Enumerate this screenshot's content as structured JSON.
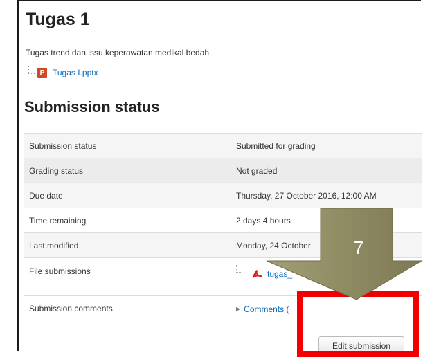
{
  "assignment": {
    "title": "Tugas 1",
    "description": "Tugas trend dan issu keperawatan medikal bedah",
    "attachment": {
      "file_name": "Tugas I.pptx",
      "icon": "powerpoint-file-icon"
    }
  },
  "submission": {
    "heading": "Submission status",
    "rows": [
      {
        "label": "Submission status",
        "value": "Submitted for grading"
      },
      {
        "label": "Grading status",
        "value": "Not graded"
      },
      {
        "label": "Due date",
        "value": "Thursday, 27 October 2016, 12:00 AM"
      },
      {
        "label": "Time remaining",
        "value": "2 days 4 hours"
      },
      {
        "label": "Last modified",
        "value": "Monday, 24 October"
      }
    ],
    "file_submissions": {
      "label": "File submissions",
      "file_name": "tugas_",
      "icon": "pdf-file-icon"
    },
    "comments": {
      "label": "Submission comments",
      "toggle": "Comments ("
    },
    "edit_button": "Edit submission"
  },
  "annotation": {
    "step_number": "7",
    "arrow_color": "#8f8b63",
    "box_color": "#f20000"
  },
  "colors": {
    "link": "#0f6cbf",
    "row_shade": "#f5f5f5"
  }
}
